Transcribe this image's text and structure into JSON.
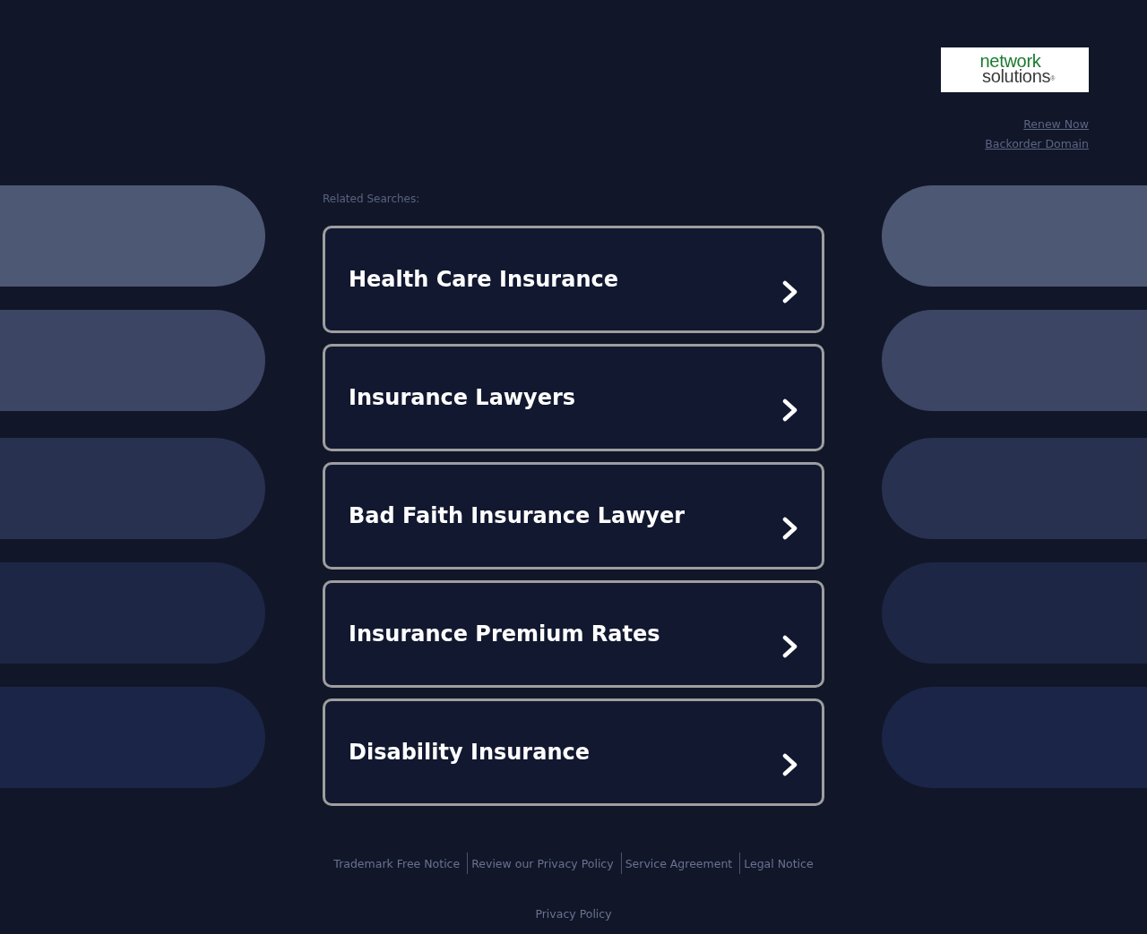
{
  "logo": {
    "line_1": "network",
    "line_2": "solutions",
    "mark": "®"
  },
  "header_links": [
    "Renew Now",
    "Backorder Domain"
  ],
  "related_searches": {
    "label": "Related Searches:",
    "items": [
      {
        "label": "Health Care Insurance"
      },
      {
        "label": "Insurance Lawyers"
      },
      {
        "label": "Bad Faith Insurance Lawyer"
      },
      {
        "label": "Insurance Premium Rates"
      },
      {
        "label": "Disability Insurance"
      }
    ]
  },
  "footer_links": [
    "Trademark Free Notice",
    "Review our Privacy Policy",
    "Service Agreement",
    "Legal Notice"
  ],
  "bottom_link": "Privacy Policy"
}
